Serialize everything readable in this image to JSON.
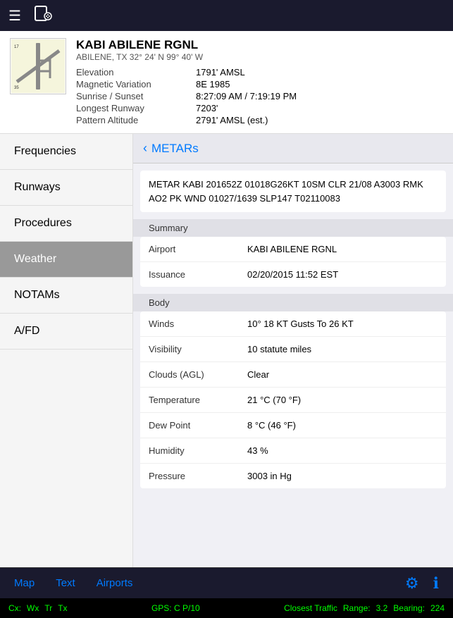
{
  "topbar": {
    "menu_icon": "☰",
    "device_icon": "📱"
  },
  "airport": {
    "id": "KABI ABILENE RGNL",
    "location": "ABILENE, TX  32° 24' N  99° 40' W",
    "elevation_label": "Elevation",
    "elevation_value": "1791' AMSL",
    "mag_var_label": "Magnetic Variation",
    "mag_var_value": "8E 1985",
    "sunrise_label": "Sunrise / Sunset",
    "sunrise_value": "8:27:09 AM / 7:19:19 PM",
    "runway_label": "Longest Runway",
    "runway_value": "7203'",
    "pattern_label": "Pattern Altitude",
    "pattern_value": "2791' AMSL (est.)"
  },
  "sidebar": {
    "items": [
      {
        "id": "frequencies",
        "label": "Frequencies",
        "active": false
      },
      {
        "id": "runways",
        "label": "Runways",
        "active": false
      },
      {
        "id": "procedures",
        "label": "Procedures",
        "active": false
      },
      {
        "id": "weather",
        "label": "Weather",
        "active": true
      },
      {
        "id": "notams",
        "label": "NOTAMs",
        "active": false
      },
      {
        "id": "afd",
        "label": "A/FD",
        "active": false
      }
    ]
  },
  "content": {
    "back_label": "METARs",
    "metar_raw": "METAR KABI 201652Z 01018G26KT 10SM CLR 21/08 A3003 RMK AO2 PK WND  01027/1639 SLP147 T02110083",
    "sections": {
      "summary_header": "Summary",
      "body_header": "Body"
    },
    "summary_rows": [
      {
        "label": "Airport",
        "value": "KABI ABILENE RGNL"
      },
      {
        "label": "Issuance",
        "value": "02/20/2015 11:52 EST"
      }
    ],
    "body_rows": [
      {
        "label": "Winds",
        "value": "10° 18 KT Gusts To 26 KT"
      },
      {
        "label": "Visibility",
        "value": "10 statute miles"
      },
      {
        "label": "Clouds (AGL)",
        "value": "Clear"
      },
      {
        "label": "Temperature",
        "value": "21 °C (70 °F)"
      },
      {
        "label": "Dew Point",
        "value": "8 °C (46 °F)"
      },
      {
        "label": "Humidity",
        "value": "43 %"
      },
      {
        "label": "Pressure",
        "value": "3003 in Hg"
      }
    ]
  },
  "bottom_tabs": {
    "map": "Map",
    "text": "Text",
    "airports": "Airports"
  },
  "status_bar": {
    "cx": "Cx:",
    "wx": "Wx",
    "tr": "Tr",
    "tx": "Tx",
    "gps": "GPS: C  P/10",
    "traffic": "Closest Traffic",
    "range_label": "Range:",
    "range_value": "3.2",
    "bearing_label": "Bearing:",
    "bearing_value": "224"
  }
}
